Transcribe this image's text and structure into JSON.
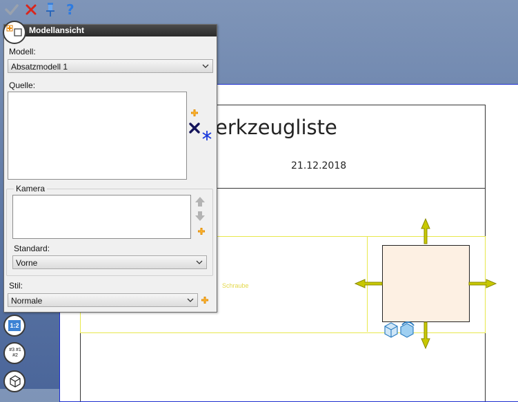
{
  "toolbar": {
    "ok_icon": "checkmark-icon",
    "cancel_icon": "red-x-icon",
    "pin_icon": "pushpin-icon",
    "help_icon": "question-mark-icon"
  },
  "sheet": {
    "title": "erkzeugliste",
    "date": "21.12.2018",
    "view_label": "Schraube"
  },
  "dialog": {
    "title": "Modellansicht",
    "model_label": "Modell:",
    "model_value": "Absatzmodell 1",
    "source_label": "Quelle:",
    "camera_label": "Kamera",
    "standard_label": "Standard:",
    "standard_value": "Vorne",
    "style_label": "Stil:",
    "style_value": "Normale"
  },
  "side_tools": {
    "scale_label": "1:2",
    "numbers_label": "#3 #1 #2"
  },
  "colors": {
    "accent_yellow": "#c8c800",
    "sheet_border": "#1a2ccf",
    "cube_fill": "#fdf0e3",
    "cancel_red": "#d9261c"
  }
}
